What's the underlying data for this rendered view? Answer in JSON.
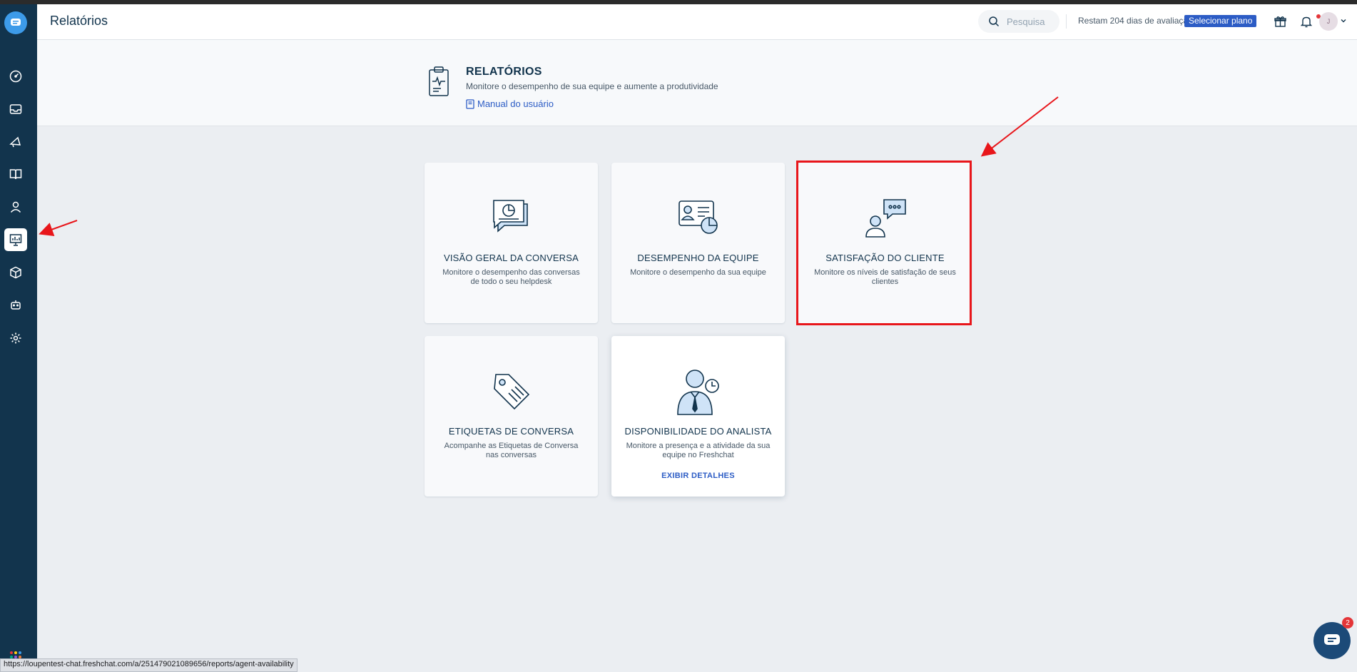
{
  "topbar": {
    "title": "Relatórios",
    "search_placeholder": "Pesquisa",
    "trial_text": "Restam 204 dias de avaliação",
    "plan_button": "Selecionar plano",
    "avatar_initial": "J"
  },
  "header": {
    "title": "RELATÓRIOS",
    "subtitle": "Monitore o desempenho de sua equipe e aumente a produtividade",
    "manual_link": "Manual do usuário"
  },
  "cards": [
    {
      "title": "VISÃO GERAL DA CONVERSA",
      "desc": "Monitore o desempenho das conversas de todo o seu helpdesk"
    },
    {
      "title": "DESEMPENHO DA EQUIPE",
      "desc": "Monitore o desempenho da sua equipe"
    },
    {
      "title": "SATISFAÇÃO DO CLIENTE",
      "desc": "Monitore os níveis de satisfação de seus clientes"
    },
    {
      "title": "ETIQUETAS DE CONVERSA",
      "desc": "Acompanhe as Etiquetas de Conversa nas conversas"
    },
    {
      "title": "DISPONIBILIDADE DO ANALISTA",
      "desc": "Monitore a presença e a atividade da sua equipe no Freshchat",
      "link": "EXIBIR DETALHES"
    }
  ],
  "status_url": "https://loupentest-chat.freshchat.com/a/251479021089656/reports/agent-availability",
  "chat_widget": {
    "badge": "2"
  },
  "colors": {
    "sidebar": "#12344d",
    "accent": "#2c5cc5",
    "highlight": "#e8161b",
    "background": "#ebeef2"
  },
  "sidebar_icons": [
    "dashboard-icon",
    "inbox-icon",
    "campaigns-icon",
    "knowledge-base-icon",
    "contacts-icon",
    "reports-icon",
    "products-icon",
    "bots-icon",
    "settings-icon",
    "apps-icon"
  ]
}
